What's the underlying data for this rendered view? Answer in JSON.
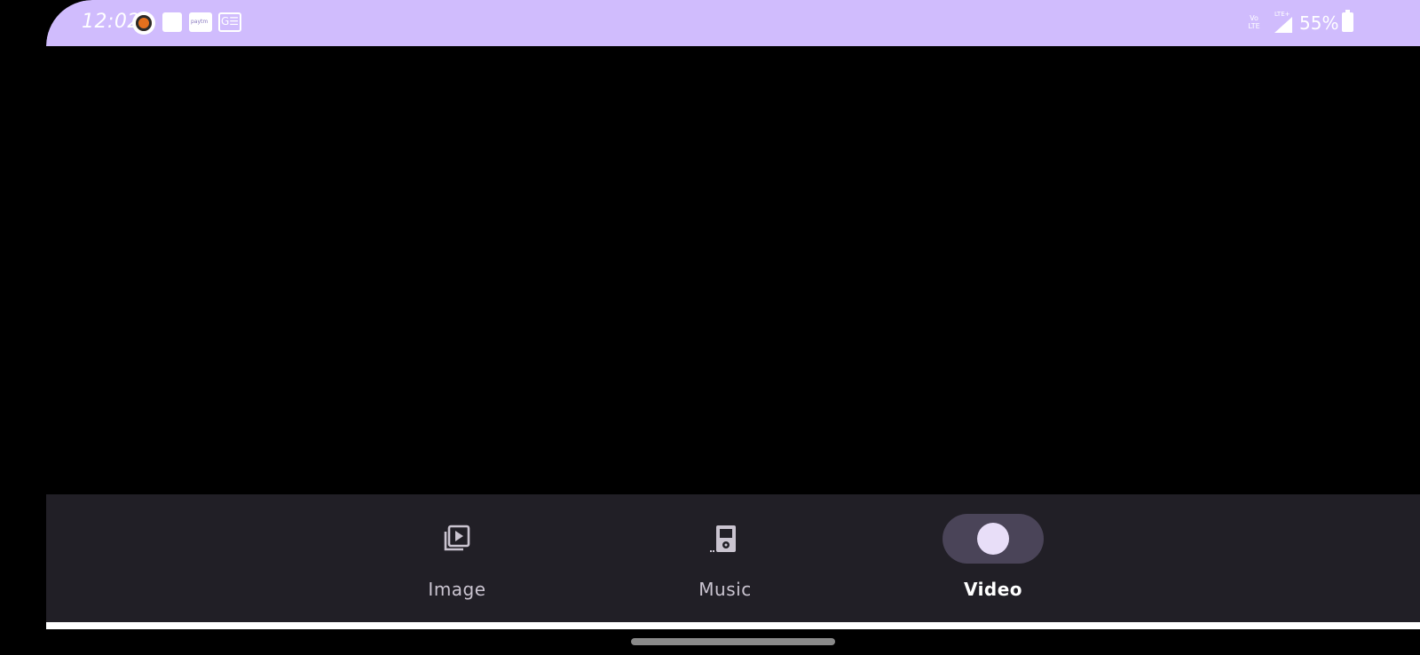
{
  "status_bar": {
    "time": "12:02",
    "notification_icons": [
      "lotus-app-icon",
      "blank-notification-icon",
      "paytm-icon",
      "ge-news-icon"
    ],
    "network": {
      "volte": "Vo LTE",
      "lte": "LTE+"
    },
    "battery_percent": "55%",
    "color": "#d0bcfd"
  },
  "bottom_nav": {
    "items": [
      {
        "label": "Image",
        "icon": "image-play-icon",
        "selected": false
      },
      {
        "label": "Music",
        "icon": "music-player-icon",
        "selected": false
      },
      {
        "label": "Video",
        "icon": "video-dot-icon",
        "selected": true
      }
    ],
    "background": "#211f26",
    "indicator_color": "#4a4458"
  }
}
